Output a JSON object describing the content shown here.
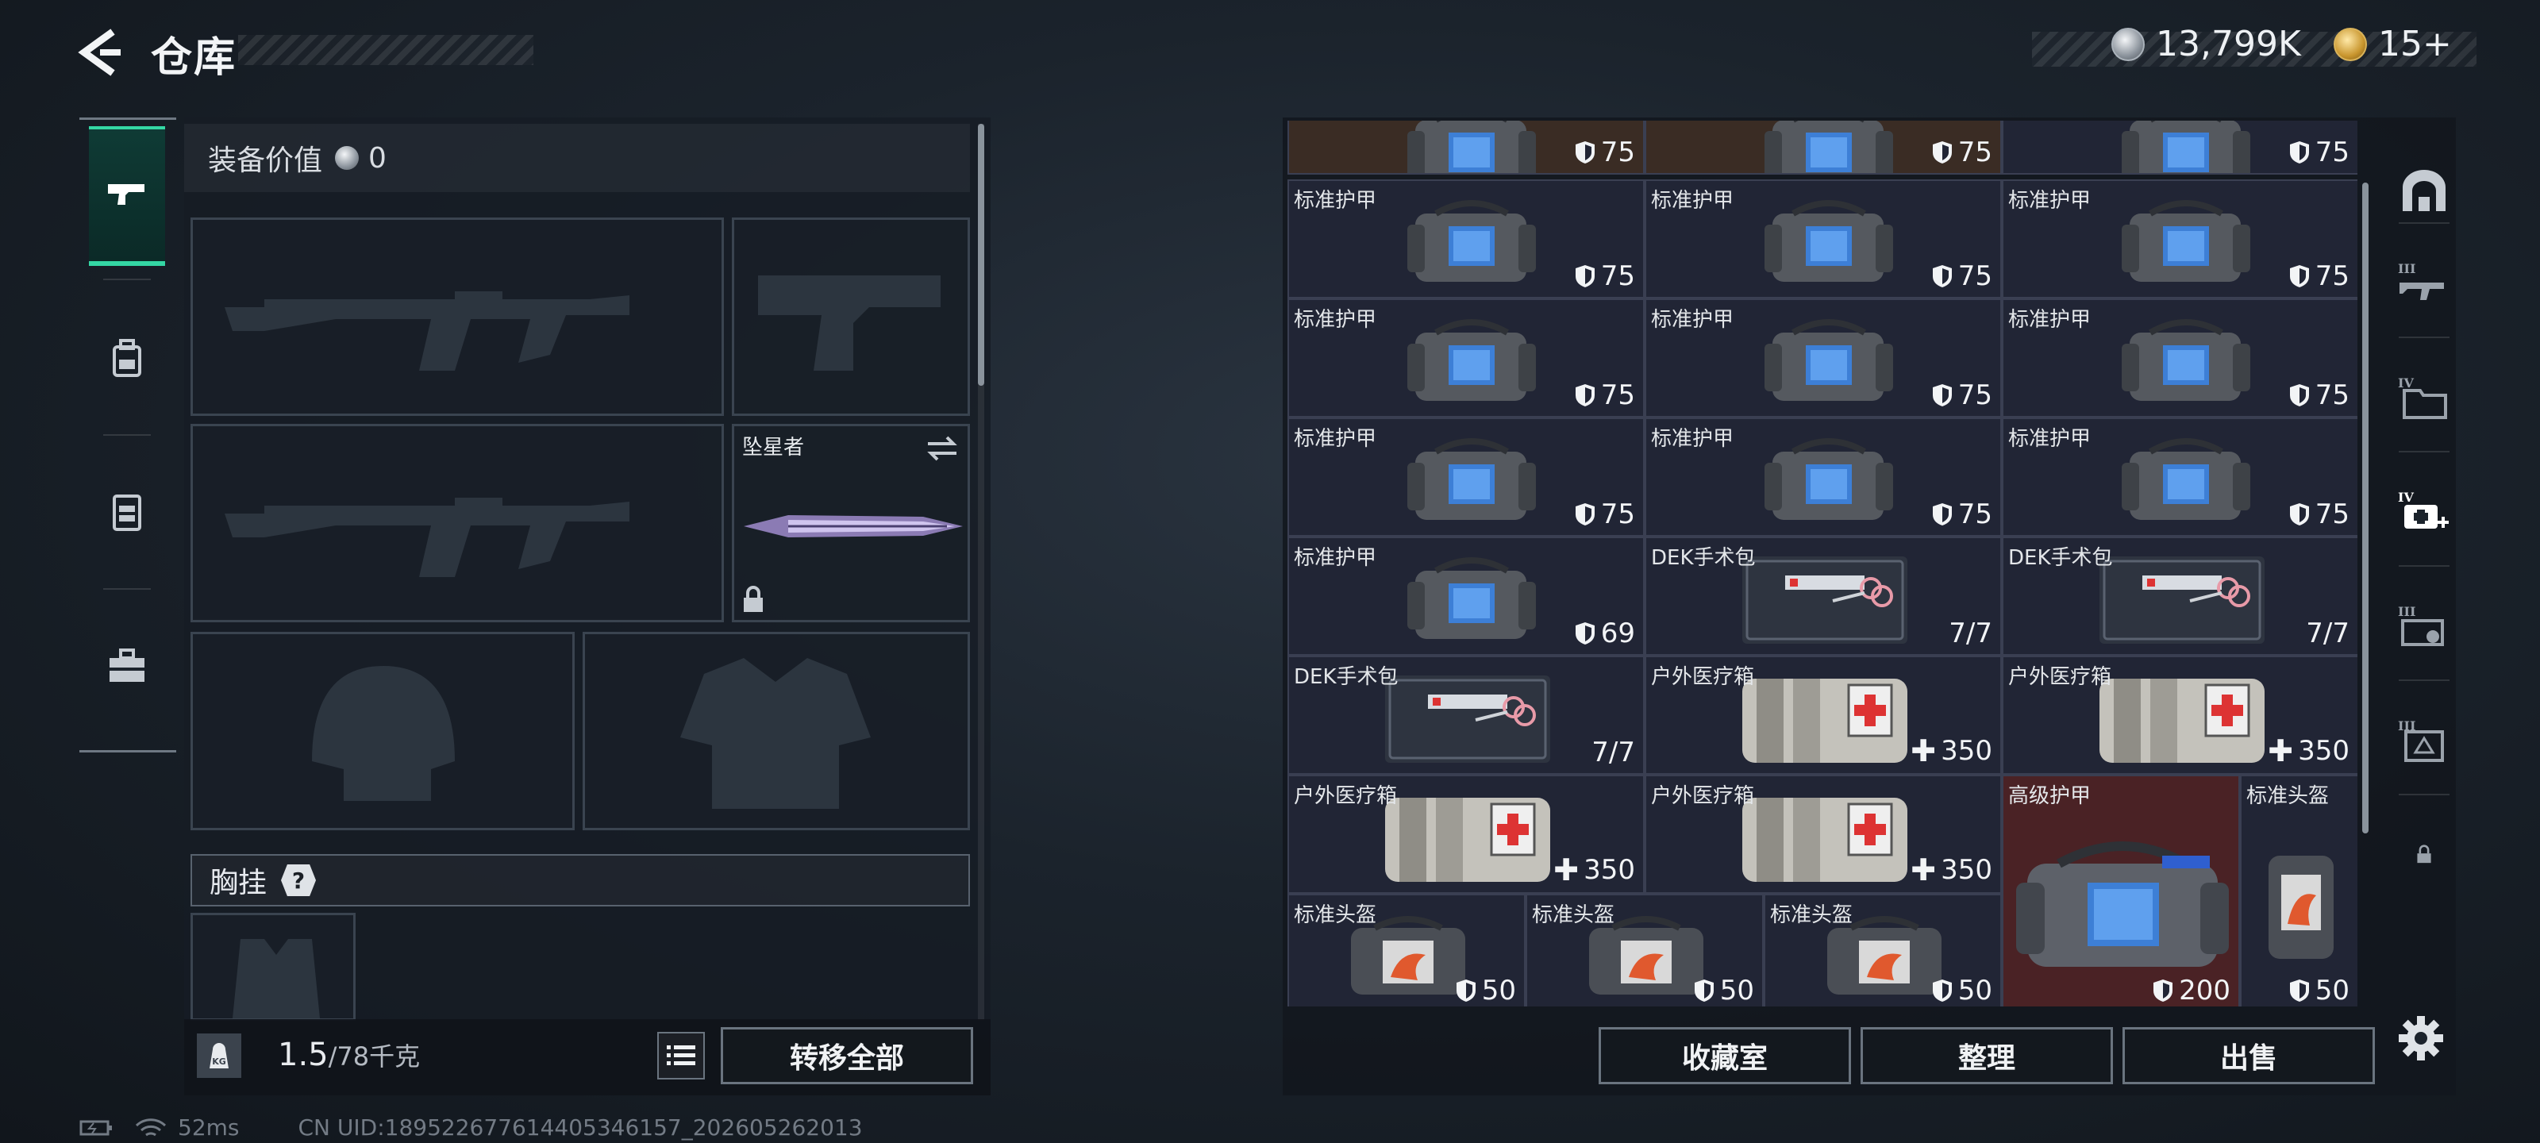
{
  "header": {
    "title": "仓库",
    "cash": "13,799K",
    "tokens": "15+"
  },
  "left_tabs": [
    {
      "name": "weapons",
      "icon": "pistol-icon",
      "active": true
    },
    {
      "name": "backpack",
      "icon": "backpack-icon",
      "active": false
    },
    {
      "name": "rig",
      "icon": "vest-icon",
      "active": false
    },
    {
      "name": "toolbox",
      "icon": "toolbox-icon",
      "active": false
    }
  ],
  "loadout": {
    "equip_value_label": "装备价值",
    "equip_value": "0",
    "melee_slot_label": "坠星者",
    "chest_rig_label": "胸挂",
    "chest_rig_help": "?"
  },
  "left_footer": {
    "weight_current": "1.5",
    "weight_max": "/78千克",
    "weight_icon_text": "KG",
    "transfer_all": "转移全部"
  },
  "storage": {
    "items": [
      {
        "name": "",
        "value": "75",
        "kind": "armor",
        "bg": "brown"
      },
      {
        "name": "",
        "value": "75",
        "kind": "armor",
        "bg": "brown"
      },
      {
        "name": "",
        "value": "75",
        "kind": "armor",
        "bg": "normal"
      },
      {
        "name": "标准护甲",
        "value": "75",
        "kind": "armor"
      },
      {
        "name": "标准护甲",
        "value": "75",
        "kind": "armor"
      },
      {
        "name": "标准护甲",
        "value": "75",
        "kind": "armor"
      },
      {
        "name": "标准护甲",
        "value": "75",
        "kind": "armor"
      },
      {
        "name": "标准护甲",
        "value": "75",
        "kind": "armor"
      },
      {
        "name": "标准护甲",
        "value": "75",
        "kind": "armor"
      },
      {
        "name": "标准护甲",
        "value": "75",
        "kind": "armor"
      },
      {
        "name": "标准护甲",
        "value": "75",
        "kind": "armor"
      },
      {
        "name": "标准护甲",
        "value": "75",
        "kind": "armor"
      },
      {
        "name": "标准护甲",
        "value": "69",
        "kind": "armor"
      },
      {
        "name": "DEK手术包",
        "value": "7/7",
        "kind": "surgery"
      },
      {
        "name": "DEK手术包",
        "value": "7/7",
        "kind": "surgery"
      },
      {
        "name": "DEK手术包",
        "value": "7/7",
        "kind": "surgery"
      },
      {
        "name": "户外医疗箱",
        "value": "350",
        "kind": "medkit"
      },
      {
        "name": "户外医疗箱",
        "value": "350",
        "kind": "medkit"
      },
      {
        "name": "户外医疗箱",
        "value": "350",
        "kind": "medkit"
      },
      {
        "name": "户外医疗箱",
        "value": "350",
        "kind": "medkit"
      },
      {
        "name": "高级护甲",
        "value": "200",
        "kind": "heavy-armor"
      },
      {
        "name": "标准头盔",
        "value": "50",
        "kind": "helmet"
      },
      {
        "name": "标准头盔",
        "value": "50",
        "kind": "helmet"
      },
      {
        "name": "标准头盔",
        "value": "50",
        "kind": "helmet"
      },
      {
        "name": "标准头盔",
        "value": "50",
        "kind": "helmet"
      }
    ],
    "collection": "收藏室",
    "sort": "整理",
    "sell": "出售"
  },
  "categories": [
    {
      "icon": "armor-rack-icon"
    },
    {
      "icon": "tier3-weapon-icon",
      "label": "III"
    },
    {
      "icon": "tier4-folder-icon",
      "label": "IV"
    },
    {
      "icon": "tier4-medkit-icon",
      "label": "IV",
      "active": true
    },
    {
      "icon": "tier3-key-icon",
      "label": "III"
    },
    {
      "icon": "tier3-safe-icon",
      "label": "III"
    },
    {
      "icon": "lock-icon"
    }
  ],
  "status": {
    "ping": "52ms",
    "uid": "CN UID:18952267761440534615​7_202605262013"
  },
  "colors": {
    "accent": "#34d7a4",
    "item_bg": "#212535",
    "legendary_bg": "#4a2225"
  }
}
